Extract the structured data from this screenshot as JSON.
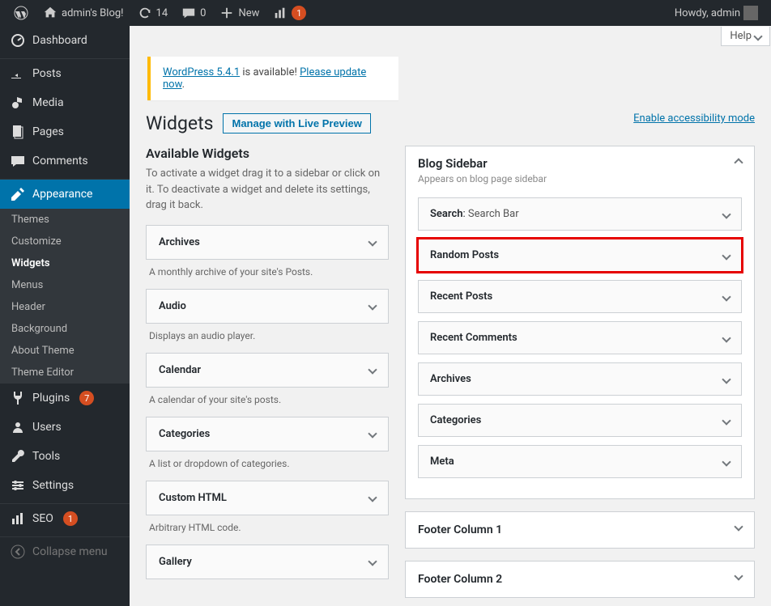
{
  "toolbar": {
    "site_name": "admin's Blog!",
    "updates": "14",
    "comments": "0",
    "new": "New",
    "seo_alert": "1",
    "greeting": "Howdy, admin"
  },
  "sidebar": {
    "items": [
      {
        "id": "dashboard",
        "label": "Dashboard"
      },
      {
        "id": "posts",
        "label": "Posts"
      },
      {
        "id": "media",
        "label": "Media"
      },
      {
        "id": "pages",
        "label": "Pages"
      },
      {
        "id": "comments",
        "label": "Comments"
      },
      {
        "id": "appearance",
        "label": "Appearance"
      },
      {
        "id": "plugins",
        "label": "Plugins",
        "badge": "7"
      },
      {
        "id": "users",
        "label": "Users"
      },
      {
        "id": "tools",
        "label": "Tools"
      },
      {
        "id": "settings",
        "label": "Settings"
      },
      {
        "id": "seo",
        "label": "SEO",
        "badge": "1"
      },
      {
        "id": "collapse",
        "label": "Collapse menu"
      }
    ],
    "appearance_submenu": [
      {
        "label": "Themes"
      },
      {
        "label": "Customize"
      },
      {
        "label": "Widgets",
        "current": true
      },
      {
        "label": "Menus"
      },
      {
        "label": "Header"
      },
      {
        "label": "Background"
      },
      {
        "label": "About Theme"
      },
      {
        "label": "Theme Editor"
      }
    ]
  },
  "content": {
    "help": "Help",
    "notice": {
      "link1": "WordPress 5.4.1",
      "mid": " is available!",
      "link2": "Please update now"
    },
    "access_link": "Enable accessibility mode",
    "title": "Widgets",
    "preview_btn": "Manage with Live Preview",
    "avail_heading": "Available Widgets",
    "avail_desc": "To activate a widget drag it to a sidebar or click on it. To deactivate a widget and delete its settings, drag it back.",
    "widgets": [
      {
        "name": "Archives",
        "desc": "A monthly archive of your site's Posts."
      },
      {
        "name": "Audio",
        "desc": "Displays an audio player."
      },
      {
        "name": "Calendar",
        "desc": "A calendar of your site's posts."
      },
      {
        "name": "Categories",
        "desc": "A list or dropdown of categories."
      },
      {
        "name": "Custom HTML",
        "desc": "Arbitrary HTML code."
      },
      {
        "name": "Gallery",
        "desc": ""
      }
    ],
    "areas": [
      {
        "name": "Blog Sidebar",
        "sub": "Appears on blog page sidebar",
        "expanded": true,
        "widgets": [
          {
            "name": "Search",
            "title": "Search Bar"
          },
          {
            "name": "Random Posts",
            "title": "",
            "highlight": true
          },
          {
            "name": "Recent Posts",
            "title": ""
          },
          {
            "name": "Recent Comments",
            "title": ""
          },
          {
            "name": "Archives",
            "title": ""
          },
          {
            "name": "Categories",
            "title": ""
          },
          {
            "name": "Meta",
            "title": ""
          }
        ]
      },
      {
        "name": "Footer Column 1",
        "expanded": false
      },
      {
        "name": "Footer Column 2",
        "expanded": false
      }
    ]
  }
}
